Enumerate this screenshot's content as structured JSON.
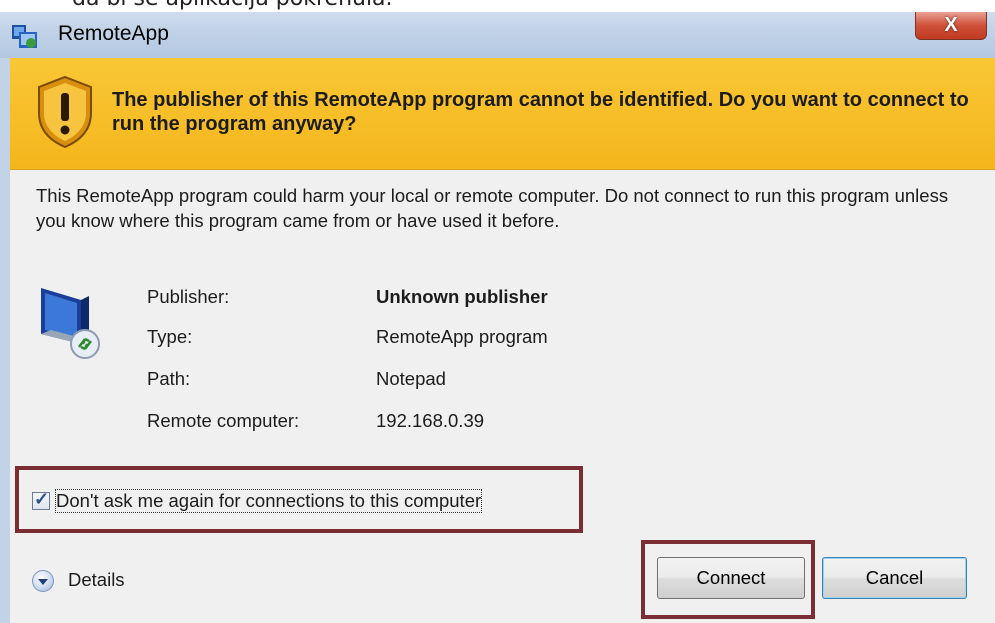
{
  "document": {
    "top_fragment": "da bi se aplikacija pokrenula."
  },
  "window": {
    "title": "RemoteApp",
    "close_label": "X"
  },
  "banner": {
    "message": "The publisher of this RemoteApp program cannot be identified. Do you want to connect to run the program anyway?"
  },
  "warning": {
    "text": "This RemoteApp program could harm your local or remote computer. Do not connect to run this program unless you know where this program came from or have used it before."
  },
  "details": {
    "publisher_label": "Publisher:",
    "publisher_value": "Unknown publisher",
    "type_label": "Type:",
    "type_value": "RemoteApp program",
    "path_label": "Path:",
    "path_value": "Notepad",
    "remote_label": "Remote computer:",
    "remote_value": "192.168.0.39"
  },
  "checkbox": {
    "label": "Don't ask me again for connections to this computer",
    "checked": true
  },
  "footer": {
    "details_label": "Details",
    "connect_label": "Connect",
    "cancel_label": "Cancel"
  },
  "icons": {
    "app": "remoteapp-icon",
    "warning": "shield-warning-icon",
    "computer": "remote-computer-icon",
    "details": "chevron-down-icon"
  },
  "colors": {
    "banner": "#f5b921",
    "highlight": "#7a2e33",
    "titlebar": "#bccfe6"
  }
}
